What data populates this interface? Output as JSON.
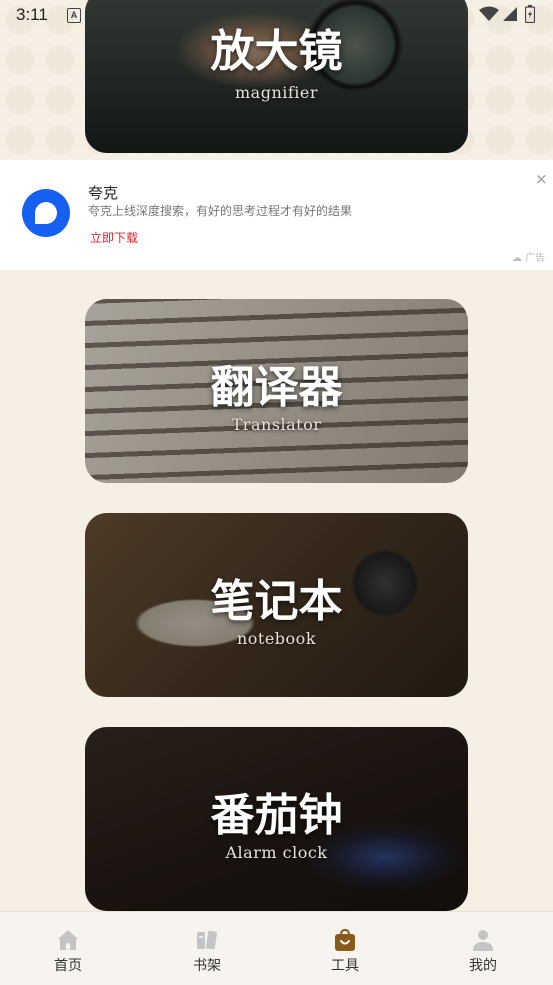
{
  "status_bar": {
    "time": "3:11",
    "notif_icon_letter": "A"
  },
  "tools": [
    {
      "title": "放大镜",
      "subtitle": "magnifier"
    },
    {
      "title": "翻译器",
      "subtitle": "Translator"
    },
    {
      "title": "笔记本",
      "subtitle": "notebook"
    },
    {
      "title": "番茄钟",
      "subtitle": "Alarm clock"
    }
  ],
  "ad": {
    "name": "夸克",
    "description": "夸克上线深度搜索，有好的思考过程才有好的结果",
    "cta": "立即下载",
    "close": "×",
    "label": "广告"
  },
  "bottom_nav": {
    "items": [
      {
        "label": "首页",
        "icon": "home-icon"
      },
      {
        "label": "书架",
        "icon": "bookshelf-icon"
      },
      {
        "label": "工具",
        "icon": "tools-bag-icon"
      },
      {
        "label": "我的",
        "icon": "profile-icon"
      }
    ],
    "active_index": 2,
    "active_color": "#8a5a1c",
    "inactive_color": "#bdbdbd"
  }
}
